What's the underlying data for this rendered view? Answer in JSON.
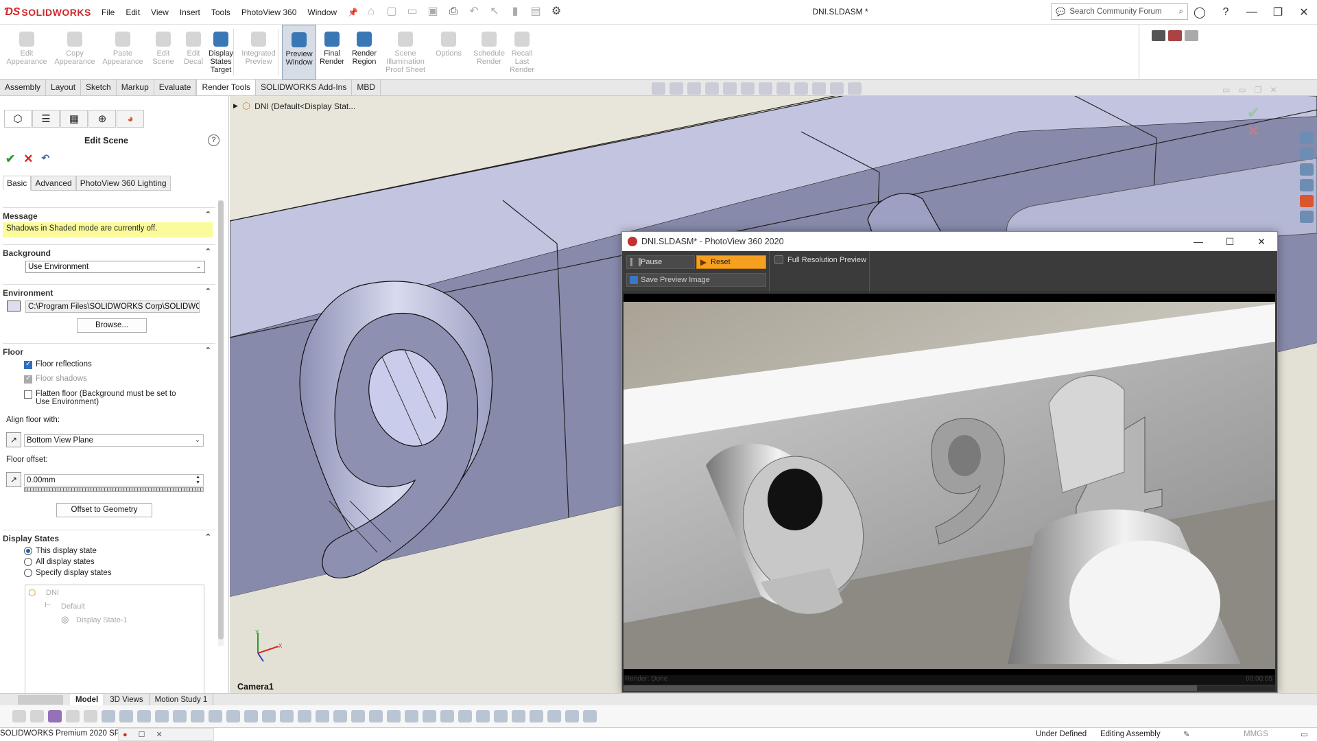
{
  "app": {
    "logo_text": "SOLIDWORKS",
    "doc_title": "DNI.SLDASM *"
  },
  "menu": [
    "File",
    "Edit",
    "View",
    "Insert",
    "Tools",
    "PhotoView 360",
    "Window"
  ],
  "search": {
    "placeholder": "Search Community Forum"
  },
  "ribbon": [
    {
      "label": "Edit\nAppearance",
      "enabled": false
    },
    {
      "label": "Copy\nAppearance",
      "enabled": false
    },
    {
      "label": "Paste\nAppearance",
      "enabled": false
    },
    {
      "label": "Edit\nScene",
      "enabled": false
    },
    {
      "label": "Edit\nDecal",
      "enabled": false
    },
    {
      "label": "Display\nStates\nTarget",
      "enabled": true
    },
    {
      "label": "Integrated\nPreview",
      "enabled": false
    },
    {
      "label": "Preview\nWindow",
      "enabled": true,
      "active": true
    },
    {
      "label": "Final\nRender",
      "enabled": true
    },
    {
      "label": "Render\nRegion",
      "enabled": true
    },
    {
      "label": "Scene\nIllumination\nProof Sheet",
      "enabled": false
    },
    {
      "label": "Options",
      "enabled": false
    },
    {
      "label": "Schedule\nRender",
      "enabled": false
    },
    {
      "label": "Recall\nLast\nRender",
      "enabled": false
    }
  ],
  "command_tabs": [
    "Assembly",
    "Layout",
    "Sketch",
    "Markup",
    "Evaluate",
    "Render Tools",
    "SOLIDWORKS Add-Ins",
    "MBD"
  ],
  "active_command_tab": "Render Tools",
  "tree_flyout": "DNI  (Default<Display Stat...",
  "property_manager": {
    "title": "Edit Scene",
    "tabs": [
      "Basic",
      "Advanced",
      "PhotoView 360 Lighting"
    ],
    "message_header": "Message",
    "message": "Shadows in Shaded mode are currently off.",
    "background_header": "Background",
    "background_value": "Use Environment",
    "environment_header": "Environment",
    "environment_path": "C:\\Program Files\\SOLIDWORKS Corp\\SOLIDWOR",
    "browse_label": "Browse...",
    "floor_header": "Floor",
    "floor_reflections": "Floor reflections",
    "floor_shadows": "Floor shadows",
    "flatten_floor": "Flatten floor (Background must be set to Use Environment)",
    "align_floor_label": "Align floor with:",
    "align_floor_value": "Bottom View Plane",
    "floor_offset_label": "Floor offset:",
    "floor_offset_value": "0.00mm",
    "offset_button": "Offset to Geometry",
    "display_states_header": "Display States",
    "radio_this": "This display state",
    "radio_all": "All display states",
    "radio_specify": "Specify display states",
    "tree_root": "DNI",
    "tree_default": "Default",
    "tree_state": "Display State-1"
  },
  "viewport": {
    "camera_label": "Camera1"
  },
  "bottom_tabs": [
    "Model",
    "3D Views",
    "Motion Study 1"
  ],
  "active_bottom_tab": "Model",
  "status": {
    "product": "SOLIDWORKS Premium 2020 SP",
    "defined": "Under Defined",
    "mode": "Editing Assembly",
    "units": "MMGS"
  },
  "photoview": {
    "title": "DNI.SLDASM* - PhotoView 360 2020",
    "pause": "Pause",
    "reset": "Reset",
    "full_res": "Full Resolution Preview",
    "save": "Save Preview Image",
    "render_status": "Render: Done",
    "render_time": "00:00:05",
    "progress": 0.88
  }
}
